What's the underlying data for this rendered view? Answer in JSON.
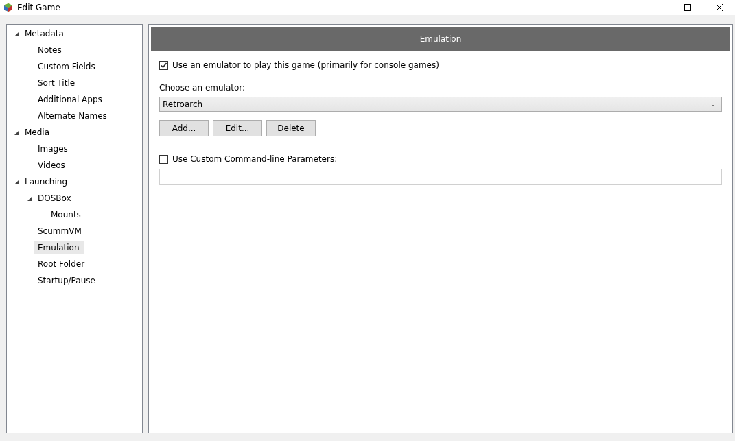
{
  "window": {
    "title": "Edit Game"
  },
  "tree": [
    {
      "label": "Metadata",
      "expanded": true,
      "selected": false,
      "children": [
        {
          "label": "Notes",
          "selected": false
        },
        {
          "label": "Custom Fields",
          "selected": false
        },
        {
          "label": "Sort Title",
          "selected": false
        },
        {
          "label": "Additional Apps",
          "selected": false
        },
        {
          "label": "Alternate Names",
          "selected": false
        }
      ]
    },
    {
      "label": "Media",
      "expanded": true,
      "selected": false,
      "children": [
        {
          "label": "Images",
          "selected": false
        },
        {
          "label": "Videos",
          "selected": false
        }
      ]
    },
    {
      "label": "Launching",
      "expanded": true,
      "selected": false,
      "children": [
        {
          "label": "DOSBox",
          "expanded": true,
          "selected": false,
          "children": [
            {
              "label": "Mounts",
              "selected": false
            }
          ]
        },
        {
          "label": "ScummVM",
          "selected": false
        },
        {
          "label": "Emulation",
          "selected": true
        },
        {
          "label": "Root Folder",
          "selected": false
        },
        {
          "label": "Startup/Pause",
          "selected": false
        }
      ]
    }
  ],
  "panel": {
    "header": "Emulation",
    "use_emulator": {
      "label": "Use an emulator to play this game (primarily for console games)",
      "checked": true
    },
    "emulator_label": "Choose an emulator:",
    "emulator": {
      "value": "Retroarch"
    },
    "buttons": [
      "Add...",
      "Edit...",
      "Delete"
    ],
    "custom_params": {
      "label": "Use Custom Command-line Parameters:",
      "checked": false
    }
  }
}
